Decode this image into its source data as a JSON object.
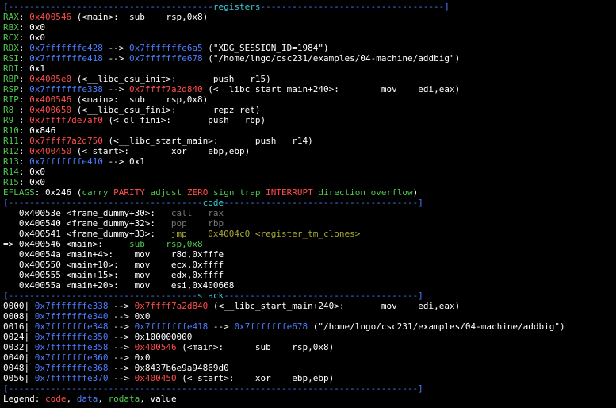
{
  "colors": {
    "background": "#000000",
    "green": "#4ec94e",
    "red": "#ff4d4d",
    "blue": "#4d7dff",
    "white": "#ffffff",
    "grey": "#777777",
    "olive": "#a8a830",
    "cyan": "#39c6d6"
  },
  "lines": [
    {
      "kind": "separator",
      "segs": [
        {
          "c": "blue",
          "t": "[---------------------------------------"
        },
        {
          "c": "cyan",
          "t": "registers"
        },
        {
          "c": "blue",
          "t": "-----------------------------------]"
        }
      ]
    },
    {
      "kind": "register",
      "name": "RAX",
      "segs": [
        {
          "c": "green",
          "t": "RAX"
        },
        {
          "c": "white",
          "t": ": "
        },
        {
          "c": "red",
          "t": "0x400546"
        },
        {
          "c": "white",
          "t": " (<main>:  sub    rsp,0x8)"
        }
      ]
    },
    {
      "kind": "register",
      "name": "RBX",
      "segs": [
        {
          "c": "green",
          "t": "RBX"
        },
        {
          "c": "white",
          "t": ": 0x0"
        }
      ]
    },
    {
      "kind": "register",
      "name": "RCX",
      "segs": [
        {
          "c": "green",
          "t": "RCX"
        },
        {
          "c": "white",
          "t": ": 0x0"
        }
      ]
    },
    {
      "kind": "register",
      "name": "RDX",
      "segs": [
        {
          "c": "green",
          "t": "RDX"
        },
        {
          "c": "white",
          "t": ": "
        },
        {
          "c": "blue",
          "t": "0x7fffffffe428"
        },
        {
          "c": "white",
          "t": " --> "
        },
        {
          "c": "blue",
          "t": "0x7fffffffe6a5"
        },
        {
          "c": "white",
          "t": " (\"XDG_SESSION_ID=1984\")"
        }
      ]
    },
    {
      "kind": "register",
      "name": "RSI",
      "segs": [
        {
          "c": "green",
          "t": "RSI"
        },
        {
          "c": "white",
          "t": ": "
        },
        {
          "c": "blue",
          "t": "0x7fffffffe418"
        },
        {
          "c": "white",
          "t": " --> "
        },
        {
          "c": "blue",
          "t": "0x7fffffffe678"
        },
        {
          "c": "white",
          "t": " (\"/home/lngo/csc231/examples/04-machine/addbig\")"
        }
      ]
    },
    {
      "kind": "register",
      "name": "RDI",
      "segs": [
        {
          "c": "green",
          "t": "RDI"
        },
        {
          "c": "white",
          "t": ": 0x1"
        }
      ]
    },
    {
      "kind": "register",
      "name": "RBP",
      "segs": [
        {
          "c": "green",
          "t": "RBP"
        },
        {
          "c": "white",
          "t": ": "
        },
        {
          "c": "red",
          "t": "0x4005e0"
        },
        {
          "c": "white",
          "t": " (<__libc_csu_init>:       push   r15)"
        }
      ]
    },
    {
      "kind": "register",
      "name": "RSP",
      "segs": [
        {
          "c": "green",
          "t": "RSP"
        },
        {
          "c": "white",
          "t": ": "
        },
        {
          "c": "blue",
          "t": "0x7fffffffe338"
        },
        {
          "c": "white",
          "t": " --> "
        },
        {
          "c": "red",
          "t": "0x7ffff7a2d840"
        },
        {
          "c": "white",
          "t": " (<__libc_start_main+240>:        mov    edi,eax)"
        }
      ]
    },
    {
      "kind": "register",
      "name": "RIP",
      "segs": [
        {
          "c": "green",
          "t": "RIP"
        },
        {
          "c": "white",
          "t": ": "
        },
        {
          "c": "red",
          "t": "0x400546"
        },
        {
          "c": "white",
          "t": " (<main>:  sub    rsp,0x8)"
        }
      ]
    },
    {
      "kind": "register",
      "name": "R8",
      "segs": [
        {
          "c": "green",
          "t": "R8 "
        },
        {
          "c": "white",
          "t": ": "
        },
        {
          "c": "red",
          "t": "0x400650"
        },
        {
          "c": "white",
          "t": " (<__libc_csu_fini>:       repz ret)"
        }
      ]
    },
    {
      "kind": "register",
      "name": "R9",
      "segs": [
        {
          "c": "green",
          "t": "R9 "
        },
        {
          "c": "white",
          "t": ": "
        },
        {
          "c": "red",
          "t": "0x7ffff7de7af0"
        },
        {
          "c": "white",
          "t": " (<_dl_fini>:       push   rbp)"
        }
      ]
    },
    {
      "kind": "register",
      "name": "R10",
      "segs": [
        {
          "c": "green",
          "t": "R10"
        },
        {
          "c": "white",
          "t": ": 0x846"
        }
      ]
    },
    {
      "kind": "register",
      "name": "R11",
      "segs": [
        {
          "c": "green",
          "t": "R11"
        },
        {
          "c": "white",
          "t": ": "
        },
        {
          "c": "red",
          "t": "0x7ffff7a2d750"
        },
        {
          "c": "white",
          "t": " (<__libc_start_main>:       push   r14)"
        }
      ]
    },
    {
      "kind": "register",
      "name": "R12",
      "segs": [
        {
          "c": "green",
          "t": "R12"
        },
        {
          "c": "white",
          "t": ": "
        },
        {
          "c": "red",
          "t": "0x400450"
        },
        {
          "c": "white",
          "t": " (<_start>:        xor    ebp,ebp)"
        }
      ]
    },
    {
      "kind": "register",
      "name": "R13",
      "segs": [
        {
          "c": "green",
          "t": "R13"
        },
        {
          "c": "white",
          "t": ": "
        },
        {
          "c": "blue",
          "t": "0x7fffffffe410"
        },
        {
          "c": "white",
          "t": " --> 0x1"
        }
      ]
    },
    {
      "kind": "register",
      "name": "R14",
      "segs": [
        {
          "c": "green",
          "t": "R14"
        },
        {
          "c": "white",
          "t": ": 0x0"
        }
      ]
    },
    {
      "kind": "register",
      "name": "R15",
      "segs": [
        {
          "c": "green",
          "t": "R15"
        },
        {
          "c": "white",
          "t": ": 0x0"
        }
      ]
    },
    {
      "kind": "flags",
      "segs": [
        {
          "c": "green",
          "t": "EFLAGS"
        },
        {
          "c": "white",
          "t": ": 0x246 ("
        },
        {
          "c": "green",
          "t": "carry "
        },
        {
          "c": "red",
          "t": "PARITY "
        },
        {
          "c": "green",
          "t": "adjust "
        },
        {
          "c": "red",
          "t": "ZERO "
        },
        {
          "c": "green",
          "t": "sign trap "
        },
        {
          "c": "red",
          "t": "INTERRUPT "
        },
        {
          "c": "green",
          "t": "direction overflow"
        },
        {
          "c": "white",
          "t": ")"
        }
      ]
    },
    {
      "kind": "separator",
      "segs": [
        {
          "c": "blue",
          "t": "[-------------------------------------"
        },
        {
          "c": "cyan",
          "t": "code"
        },
        {
          "c": "blue",
          "t": "-------------------------------------]"
        }
      ]
    },
    {
      "kind": "code",
      "segs": [
        {
          "c": "white",
          "t": "   0x40053e <frame_dummy+30>:   "
        },
        {
          "c": "grey",
          "t": "call   rax"
        }
      ]
    },
    {
      "kind": "code",
      "segs": [
        {
          "c": "white",
          "t": "   0x400540 <frame_dummy+32>:   "
        },
        {
          "c": "grey",
          "t": "pop    rbp"
        }
      ]
    },
    {
      "kind": "code",
      "segs": [
        {
          "c": "white",
          "t": "   0x400541 <frame_dummy+33>:   "
        },
        {
          "c": "olive",
          "t": "jmp    0x4004c0 <register_tm_clones>"
        }
      ]
    },
    {
      "kind": "code-current",
      "segs": [
        {
          "c": "white",
          "t": "=> 0x400546 <main>:     "
        },
        {
          "c": "green",
          "t": "sub    rsp,0x8"
        }
      ]
    },
    {
      "kind": "code",
      "segs": [
        {
          "c": "white",
          "t": "   0x40054a <main+4>:    mov    r8d,0xfffe"
        }
      ]
    },
    {
      "kind": "code",
      "segs": [
        {
          "c": "white",
          "t": "   0x400550 <main+10>:   mov    ecx,0xffff"
        }
      ]
    },
    {
      "kind": "code",
      "segs": [
        {
          "c": "white",
          "t": "   0x400555 <main+15>:   mov    edx,0xffff"
        }
      ]
    },
    {
      "kind": "code",
      "segs": [
        {
          "c": "white",
          "t": "   0x40055a <main+20>:   mov    esi,0x400668"
        }
      ]
    },
    {
      "kind": "separator",
      "segs": [
        {
          "c": "blue",
          "t": "[------------------------------------"
        },
        {
          "c": "cyan",
          "t": "stack"
        },
        {
          "c": "blue",
          "t": "-------------------------------------]"
        }
      ]
    },
    {
      "kind": "stack",
      "segs": [
        {
          "c": "white",
          "t": "0000| "
        },
        {
          "c": "blue",
          "t": "0x7fffffffe338"
        },
        {
          "c": "white",
          "t": " --> "
        },
        {
          "c": "red",
          "t": "0x7ffff7a2d840"
        },
        {
          "c": "white",
          "t": " (<__libc_start_main+240>:       mov    edi,eax)"
        }
      ]
    },
    {
      "kind": "stack",
      "segs": [
        {
          "c": "white",
          "t": "0008| "
        },
        {
          "c": "blue",
          "t": "0x7fffffffe340"
        },
        {
          "c": "white",
          "t": " --> 0x0"
        }
      ]
    },
    {
      "kind": "stack",
      "segs": [
        {
          "c": "white",
          "t": "0016| "
        },
        {
          "c": "blue",
          "t": "0x7fffffffe348"
        },
        {
          "c": "white",
          "t": " --> "
        },
        {
          "c": "blue",
          "t": "0x7fffffffe418"
        },
        {
          "c": "white",
          "t": " --> "
        },
        {
          "c": "blue",
          "t": "0x7fffffffe678"
        },
        {
          "c": "white",
          "t": " (\"/home/lngo/csc231/examples/04-machine/addbig\")"
        }
      ]
    },
    {
      "kind": "stack",
      "segs": [
        {
          "c": "white",
          "t": "0024| "
        },
        {
          "c": "blue",
          "t": "0x7fffffffe350"
        },
        {
          "c": "white",
          "t": " --> 0x100000000"
        }
      ]
    },
    {
      "kind": "stack",
      "segs": [
        {
          "c": "white",
          "t": "0032| "
        },
        {
          "c": "blue",
          "t": "0x7fffffffe358"
        },
        {
          "c": "white",
          "t": " --> "
        },
        {
          "c": "red",
          "t": "0x400546"
        },
        {
          "c": "white",
          "t": " (<main>:      sub    rsp,0x8)"
        }
      ]
    },
    {
      "kind": "stack",
      "segs": [
        {
          "c": "white",
          "t": "0040| "
        },
        {
          "c": "blue",
          "t": "0x7fffffffe360"
        },
        {
          "c": "white",
          "t": " --> 0x0"
        }
      ]
    },
    {
      "kind": "stack",
      "segs": [
        {
          "c": "white",
          "t": "0048| "
        },
        {
          "c": "blue",
          "t": "0x7fffffffe368"
        },
        {
          "c": "white",
          "t": " --> 0x8437b6e9a94869d0"
        }
      ]
    },
    {
      "kind": "stack",
      "segs": [
        {
          "c": "white",
          "t": "0056| "
        },
        {
          "c": "blue",
          "t": "0x7fffffffe370"
        },
        {
          "c": "white",
          "t": " --> "
        },
        {
          "c": "red",
          "t": "0x400450"
        },
        {
          "c": "white",
          "t": " (<_start>:    xor    ebp,ebp)"
        }
      ]
    },
    {
      "kind": "separator",
      "segs": [
        {
          "c": "blue",
          "t": "[------------------------------------------------------------------------------]"
        }
      ]
    },
    {
      "kind": "legend",
      "segs": [
        {
          "c": "white",
          "t": "Legend: "
        },
        {
          "c": "red",
          "t": "code"
        },
        {
          "c": "white",
          "t": ", "
        },
        {
          "c": "blue",
          "t": "data"
        },
        {
          "c": "white",
          "t": ", "
        },
        {
          "c": "green",
          "t": "rodata"
        },
        {
          "c": "white",
          "t": ", value"
        }
      ]
    }
  ]
}
